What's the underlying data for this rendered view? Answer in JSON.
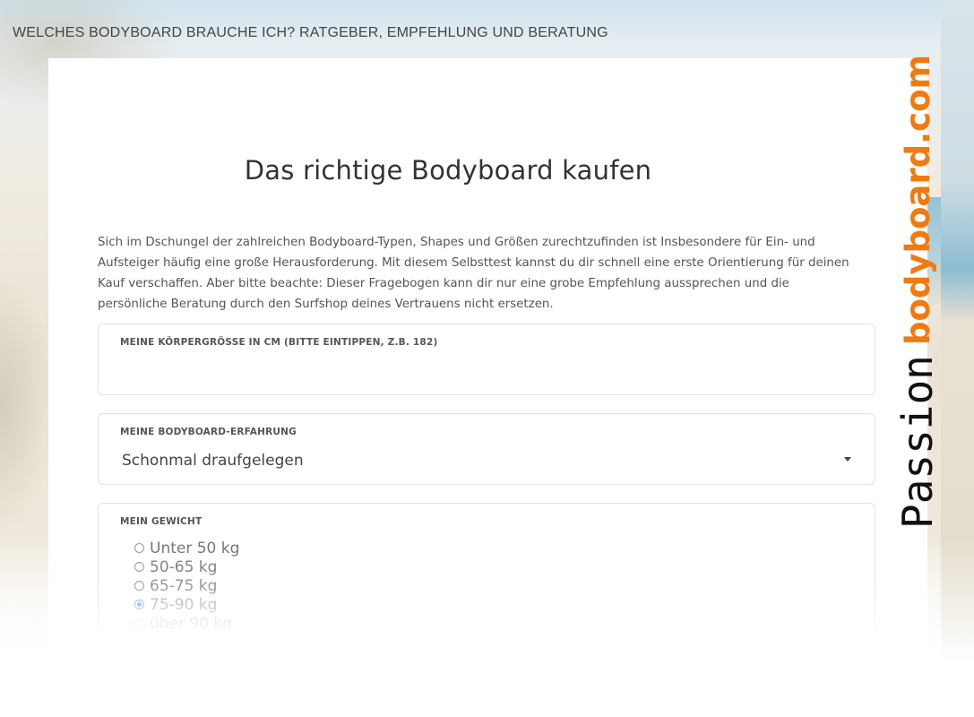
{
  "header": {
    "title": "WELCHES BODYBOARD BRAUCHE ICH? RATGEBER, EMPFEHLUNG UND BERATUNG"
  },
  "main": {
    "title": "Das richtige Bodyboard kaufen",
    "intro_lines": [
      "Sich im Dschungel der zahlreichen Bodyboard-Typen, Shapes und Größen zurechtzufinden ist Insbesondere für Ein- und",
      "Aufsteiger häufig eine große Herausforderung. Mit diesem Selbsttest kannst du dir schnell eine erste Orientierung für deinen",
      "Kauf verschaffen. Aber bitte beachte: Dieser Fragebogen kann dir nur eine grobe Empfehlung aussprechen und die",
      "persönliche Beratung durch den Surfshop deines Vertrauens nicht ersetzen."
    ]
  },
  "form": {
    "height": {
      "label": "MEINE KÖRPERGRÖSSE IN CM (BITTE EINTIPPEN, Z.B. 182)",
      "value": ""
    },
    "experience": {
      "label": "MEINE BODYBOARD-ERFAHRUNG",
      "selected": "Schonmal draufgelegen"
    },
    "weight": {
      "label": "MEIN GEWICHT",
      "options": [
        "Unter 50 kg",
        "50-65 kg",
        "65-75 kg",
        "75-90 kg",
        "über 90 kg"
      ],
      "selected_index": 3
    }
  },
  "logo": {
    "text_a": "Passion",
    "text_b": "bodyboard.com",
    "color_a": "#111111",
    "color_b": "#f07a12"
  },
  "colors": {
    "radio_checked": "#6fa3e8"
  }
}
